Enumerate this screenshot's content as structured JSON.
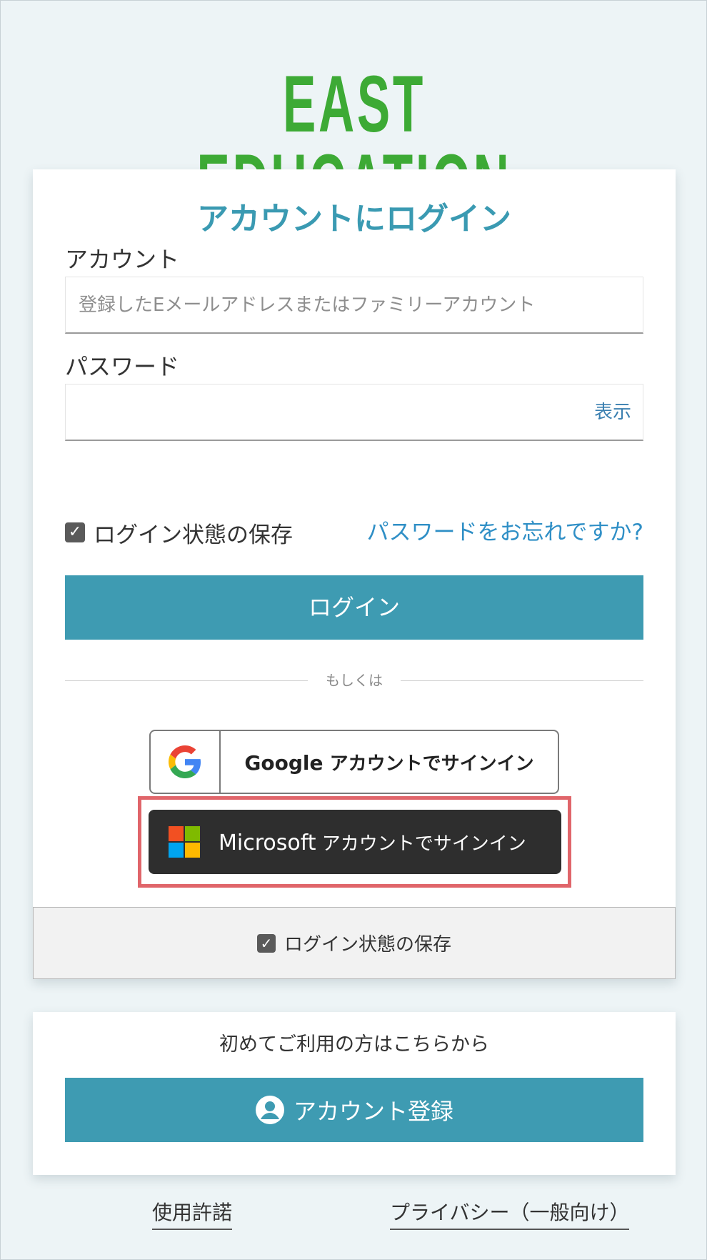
{
  "brand": {
    "logo_text": "EAST EDUCATION",
    "logo_color": "#3daa35"
  },
  "login": {
    "title": "アカウントにログイン",
    "account_label": "アカウント",
    "account_placeholder": "登録したEメールアドレスまたはファミリーアカウント",
    "password_label": "パスワード",
    "password_value": "",
    "show_password": "表示",
    "remember_checked": true,
    "remember_label": "ログイン状態の保存",
    "forgot_link": "パスワードをお忘れですか?",
    "login_button": "ログイン",
    "or_divider": "もしくは",
    "google": {
      "brand": "Google",
      "label": "アカウントでサインイン"
    },
    "microsoft": {
      "brand": "Microsoft",
      "label": "アカウントでサインイン"
    },
    "footer_remember_checked": true,
    "footer_remember_label": "ログイン状態の保存"
  },
  "register": {
    "intro": "初めてご利用の方はこちらから",
    "button": "アカウント登録"
  },
  "footer": {
    "terms_link": "使用許諾",
    "privacy_link": "プライバシー（一般向け）"
  },
  "colors": {
    "accent": "#3e9bb2",
    "title": "#3a9ab2",
    "link": "#2f8fc6",
    "highlight": "#e0656a",
    "ms_dark": "#2e2e2e"
  },
  "icons": {
    "google": "google-logo-icon",
    "microsoft": "microsoft-logo-icon",
    "checkbox": "check-icon",
    "user": "user-circle-icon"
  }
}
